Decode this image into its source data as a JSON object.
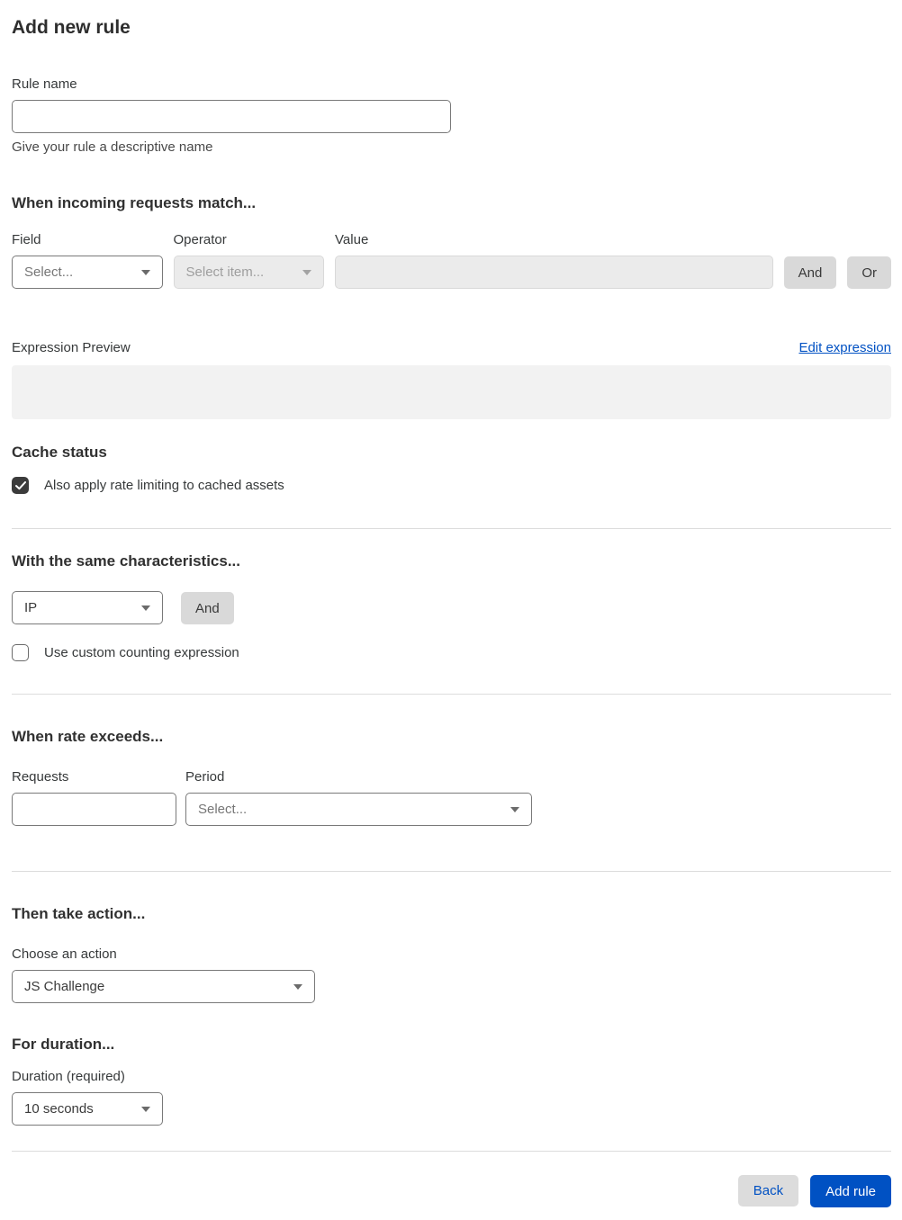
{
  "page": {
    "title": "Add new rule"
  },
  "rule_name": {
    "label": "Rule name",
    "value": "",
    "helper": "Give your rule a descriptive name"
  },
  "match": {
    "heading": "When incoming requests match...",
    "field": {
      "label": "Field",
      "value": "Select..."
    },
    "operator": {
      "label": "Operator",
      "value": "Select item...",
      "disabled": true
    },
    "value": {
      "label": "Value",
      "value": "",
      "disabled": true
    },
    "and_label": "And",
    "or_label": "Or"
  },
  "expression": {
    "label": "Expression Preview",
    "edit_link": "Edit expression",
    "value": ""
  },
  "cache": {
    "heading": "Cache status",
    "checkbox_label": "Also apply rate limiting to cached assets",
    "checked": true
  },
  "characteristics": {
    "heading": "With the same characteristics...",
    "select_value": "IP",
    "and_label": "And",
    "custom_checkbox_label": "Use custom counting expression",
    "custom_checked": false
  },
  "rate": {
    "heading": "When rate exceeds...",
    "requests": {
      "label": "Requests",
      "value": ""
    },
    "period": {
      "label": "Period",
      "value": "Select..."
    }
  },
  "action": {
    "heading": "Then take action...",
    "label": "Choose an action",
    "value": "JS Challenge"
  },
  "duration": {
    "heading": "For duration...",
    "label": "Duration (required)",
    "value": "10 seconds"
  },
  "footer": {
    "back_label": "Back",
    "add_label": "Add rule"
  },
  "colors": {
    "primary_blue": "#0051c3",
    "link_blue": "#0051c3",
    "checkbox_dark": "#3b3b3b",
    "disabled_bg": "#ebebeb",
    "preview_bg": "#f2f2f2",
    "grey_button_bg": "#d9d9d9",
    "divider": "#dcdcdc"
  }
}
